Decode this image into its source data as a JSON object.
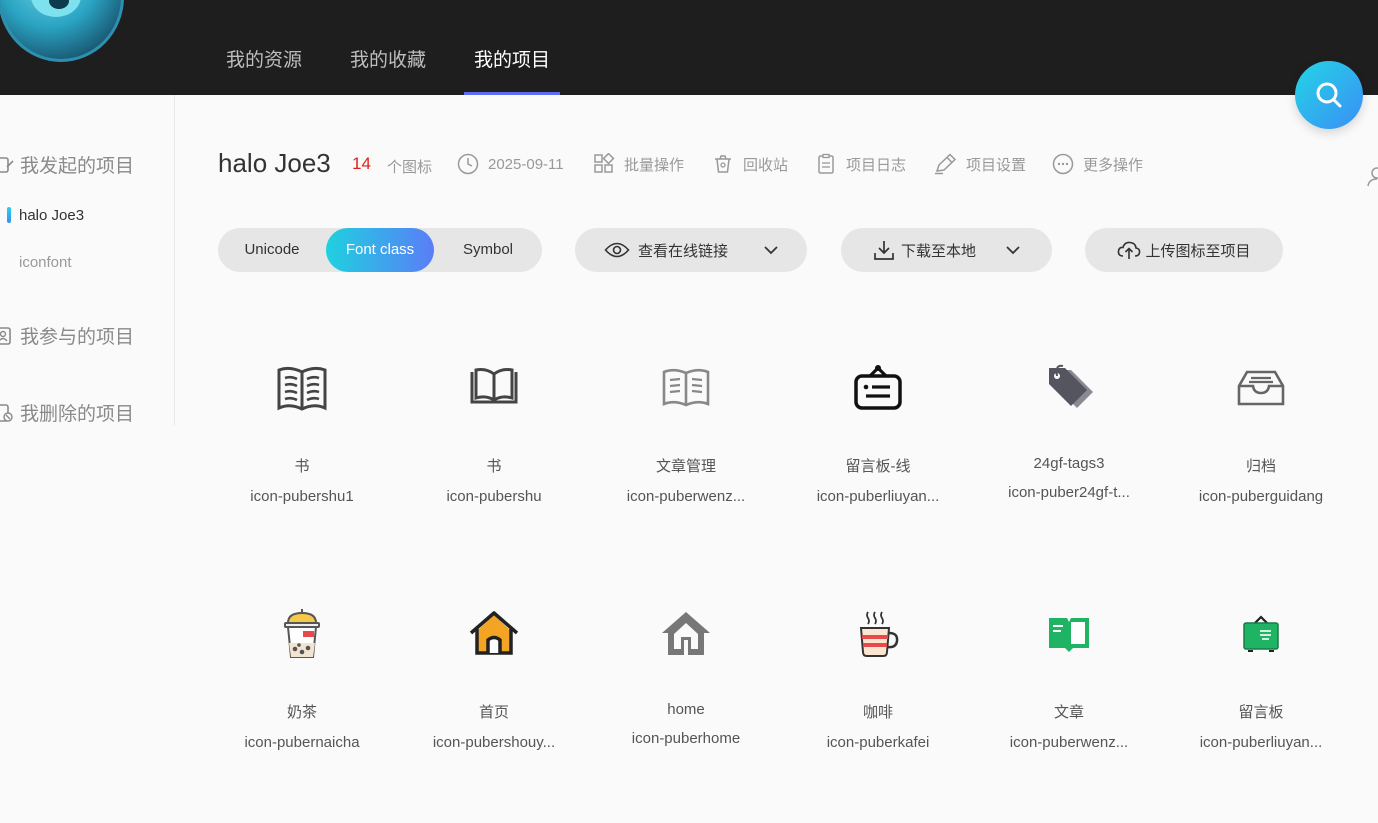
{
  "top_nav": {
    "tabs": [
      {
        "label": "我的资源"
      },
      {
        "label": "我的收藏"
      },
      {
        "label": "我的项目"
      }
    ]
  },
  "sidebar": {
    "groups": [
      {
        "label": "我发起的项目"
      },
      {
        "label": "我参与的项目"
      },
      {
        "label": "我删除的项目"
      }
    ],
    "items": [
      {
        "label": "halo Joe3"
      },
      {
        "label": "iconfont"
      }
    ]
  },
  "project": {
    "title": "halo Joe3",
    "count": "14",
    "count_label": "个图标",
    "date": "2025-09-11",
    "actions": {
      "batch": "批量操作",
      "recycle": "回收站",
      "log": "项目日志",
      "settings": "项目设置",
      "more": "更多操作"
    }
  },
  "toolbar": {
    "modes": [
      "Unicode",
      "Font class",
      "Symbol"
    ],
    "online_link": "查看在线链接",
    "download": "下载至本地",
    "upload": "上传图标至项目"
  },
  "icons": [
    {
      "name": "书",
      "class": "icon-pubershu1",
      "icon": "book-lines-icon"
    },
    {
      "name": "书",
      "class": "icon-pubershu",
      "icon": "open-book-icon"
    },
    {
      "name": "文章管理",
      "class": "icon-puberwenz...",
      "icon": "article-icon"
    },
    {
      "name": "留言板-线",
      "class": "icon-puberliuyan...",
      "icon": "message-board-icon"
    },
    {
      "name": "24gf-tags3",
      "class": "icon-puber24gf-t...",
      "icon": "tags-icon"
    },
    {
      "name": "归档",
      "class": "icon-puberguidang",
      "icon": "archive-icon"
    },
    {
      "name": "奶茶",
      "class": "icon-pubernaicha",
      "icon": "milk-tea-icon"
    },
    {
      "name": "首页",
      "class": "icon-pubershouy...",
      "icon": "home-color-icon"
    },
    {
      "name": "home",
      "class": "icon-puberhome",
      "icon": "home-gray-icon"
    },
    {
      "name": "咖啡",
      "class": "icon-puberkafei",
      "icon": "coffee-icon"
    },
    {
      "name": "文章",
      "class": "icon-puberwenz...",
      "icon": "article-green-icon"
    },
    {
      "name": "留言板",
      "class": "icon-puberliuyan...",
      "icon": "message-board-green-icon"
    }
  ],
  "colors": {
    "accent_start": "#23d5e6",
    "accent_end": "#5a7df7",
    "count_red": "#e0201b",
    "topbar": "#1e1e1e"
  }
}
